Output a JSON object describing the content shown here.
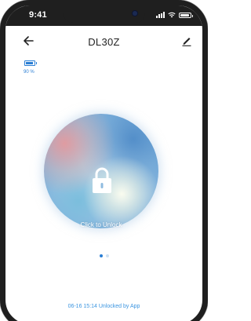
{
  "status_bar": {
    "time": "9:41"
  },
  "header": {
    "title": "DL30Z"
  },
  "battery": {
    "text": "90 %",
    "level": 0.9
  },
  "unlock": {
    "label": "Click to Unlock"
  },
  "pager": {
    "count": 2,
    "active_index": 0
  },
  "last_event": {
    "text": "06-16 15:14 Unlocked by App"
  },
  "colors": {
    "accent": "#2a7ed4",
    "log_text": "#3b95e0"
  },
  "icons": [
    "back-arrow-icon",
    "edit-pen-icon",
    "battery-icon",
    "lock-icon"
  ]
}
